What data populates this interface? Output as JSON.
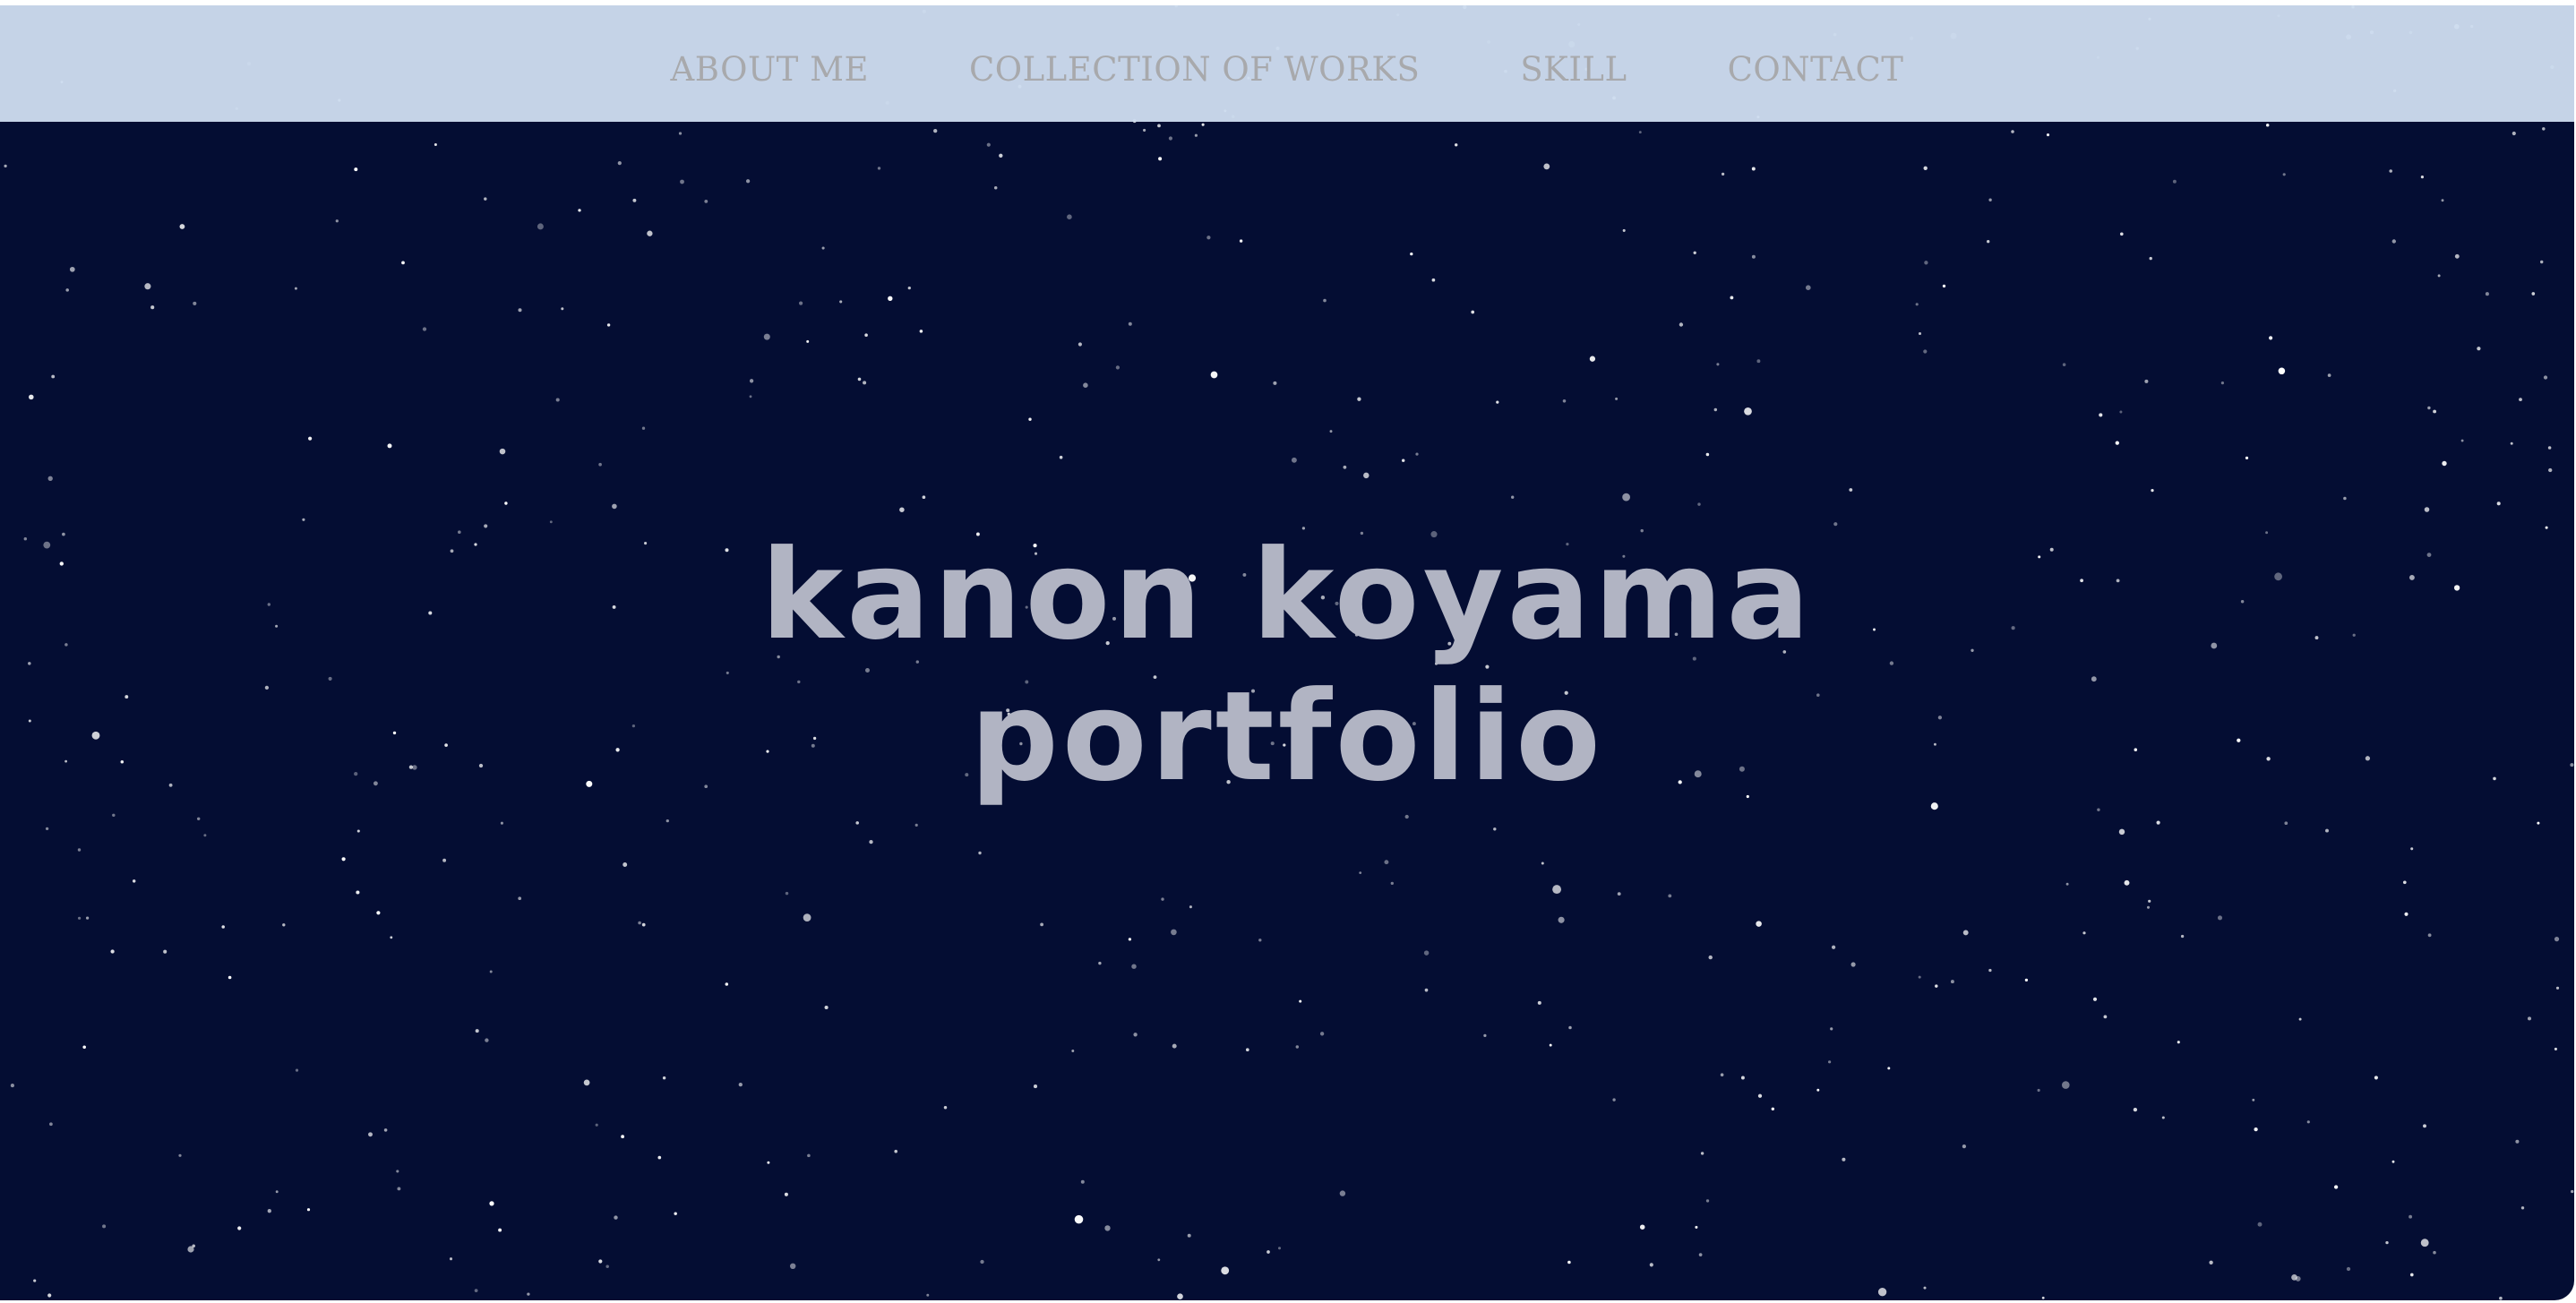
{
  "nav": {
    "items": [
      {
        "label": "ABOUT ME"
      },
      {
        "label": "COLLECTION OF WORKS"
      },
      {
        "label": "SKILL"
      },
      {
        "label": "CONTACT"
      }
    ]
  },
  "hero": {
    "title_line1": "kanon koyama",
    "title_line2": "portfolio"
  },
  "colors": {
    "background": "#040d33",
    "navbar": "#cddcee",
    "nav_text": "#a8a9ac",
    "hero_text": "#b1b4c3",
    "star": "#ffffff"
  }
}
